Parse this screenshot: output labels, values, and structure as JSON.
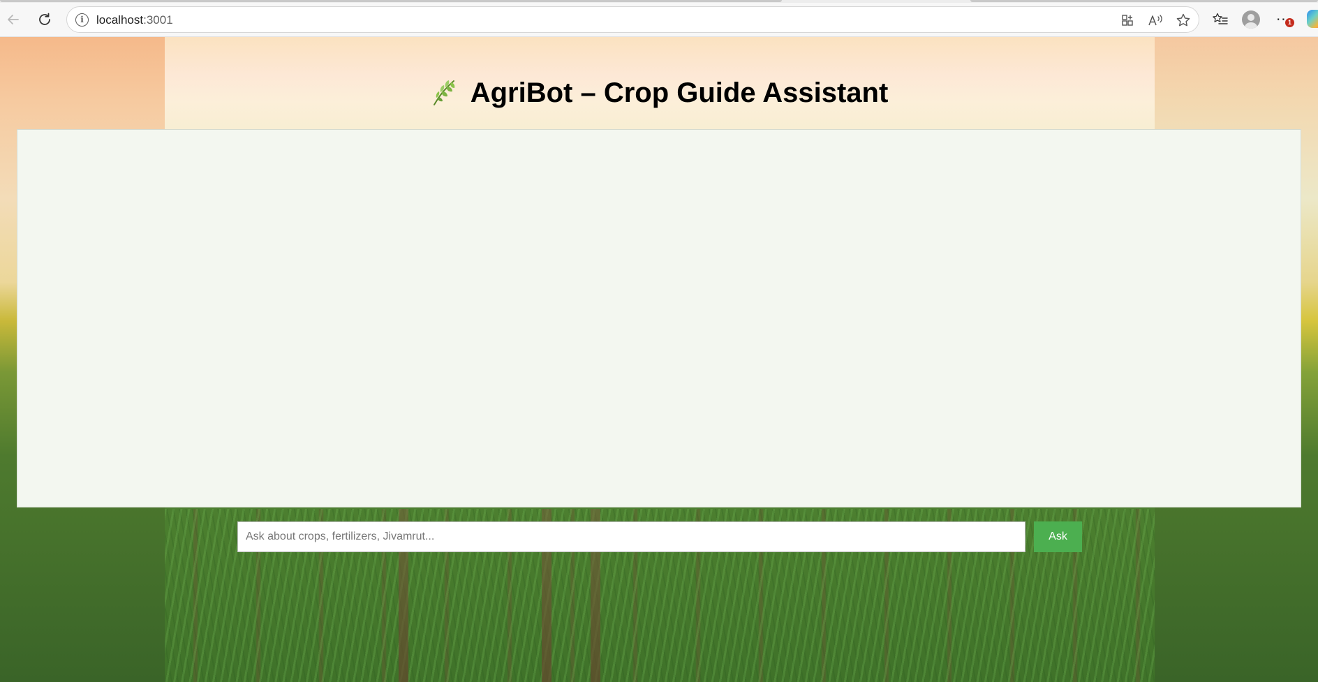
{
  "browser": {
    "url_host": "localhost",
    "url_port": ":3001",
    "notification_count": "1",
    "icons": {
      "back": "back-arrow-icon",
      "reload": "reload-icon",
      "site_info": "info-icon",
      "app_available": "app-grid-icon",
      "read_aloud": "read-aloud-icon",
      "favorite": "star-icon",
      "favorites_list": "favorites-list-icon",
      "profile": "profile-avatar-icon",
      "more": "more-menu-icon",
      "copilot": "copilot-icon"
    }
  },
  "app": {
    "title": "AgriBot – Crop Guide Assistant",
    "title_icon": "herb-leaf-icon",
    "chat_messages": [],
    "input_placeholder": "Ask about crops, fertilizers, Jivamrut...",
    "input_value": "",
    "ask_label": "Ask"
  },
  "colors": {
    "accent_button": "#4caf50",
    "chat_background": "#f3f7f0",
    "title_text": "#000000"
  }
}
